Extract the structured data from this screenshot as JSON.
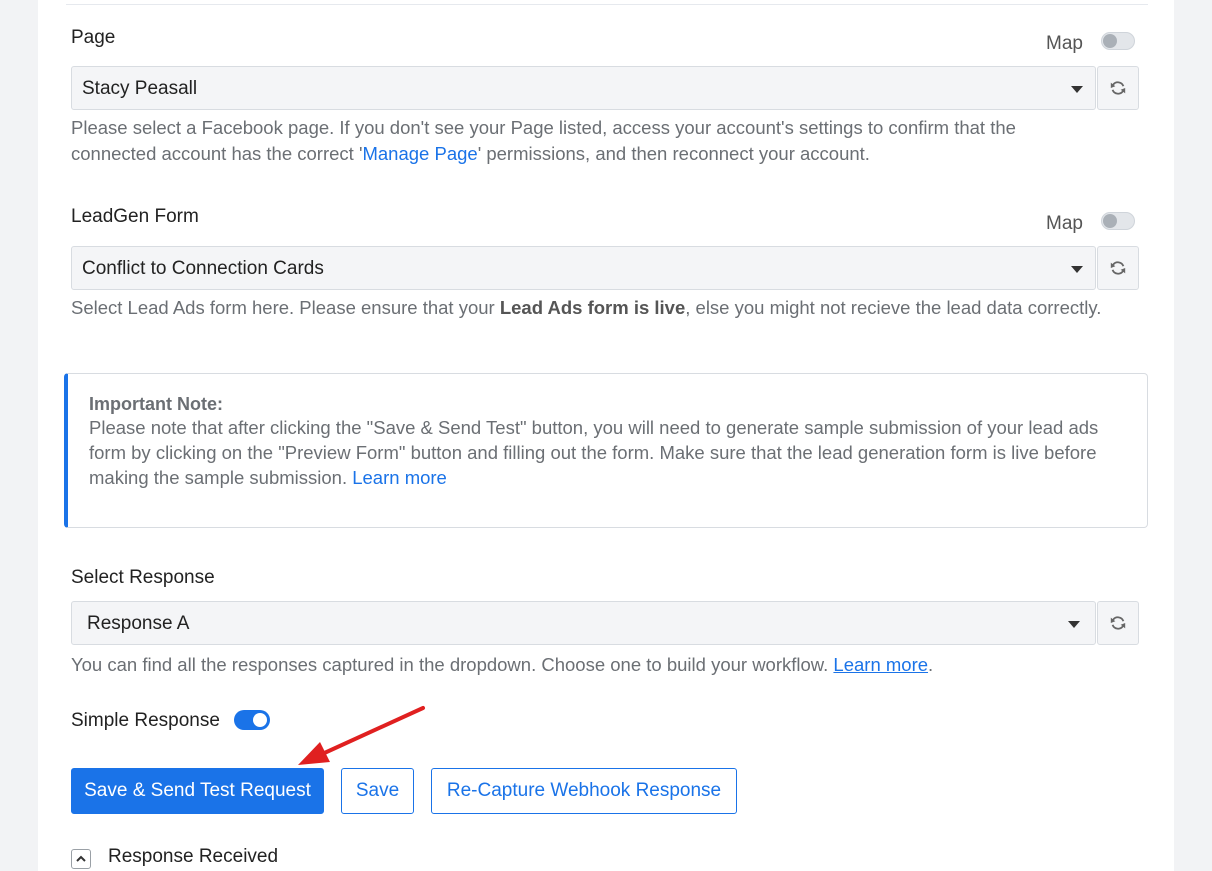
{
  "page_field": {
    "label": "Page",
    "map_label": "Map",
    "value": "Stacy Peasall",
    "help_before": "Please select a Facebook page. If you don't see your Page listed, access your account's settings to confirm that the connected account has the correct '",
    "help_link": "Manage Page",
    "help_after": "' permissions, and then reconnect your account."
  },
  "leadgen_field": {
    "label": "LeadGen Form",
    "map_label": "Map",
    "value": "Conflict to Connection Cards",
    "help_before": "Select Lead Ads form here. Please ensure that your ",
    "help_bold": "Lead Ads form is live",
    "help_after": ", else you might not recieve the lead data correctly."
  },
  "note": {
    "title": "Important Note:",
    "body": "Please note that after clicking the \"Save & Send Test\" button, you will need to generate sample submission of your lead ads form by clicking on the \"Preview Form\" button and filling out the form. Make sure that the lead generation form is live before making the sample submission. ",
    "link": "Learn more"
  },
  "response_field": {
    "label": "Select Response",
    "value": "Response A",
    "help_before": "You can find all the responses captured in the dropdown. Choose one to build your workflow. ",
    "help_link": "Learn more",
    "help_after": "."
  },
  "simple_response": {
    "label": "Simple Response",
    "enabled": true
  },
  "buttons": {
    "save_send": "Save & Send Test Request",
    "save": "Save",
    "recapture": "Re-Capture Webhook Response"
  },
  "response_received": {
    "label": "Response Received"
  },
  "colors": {
    "accent": "#1a73e8",
    "arrow": "#e02020"
  },
  "icons": [
    "refresh-icon",
    "chevron-up-icon",
    "caret-down-icon",
    "annotation-arrow"
  ]
}
